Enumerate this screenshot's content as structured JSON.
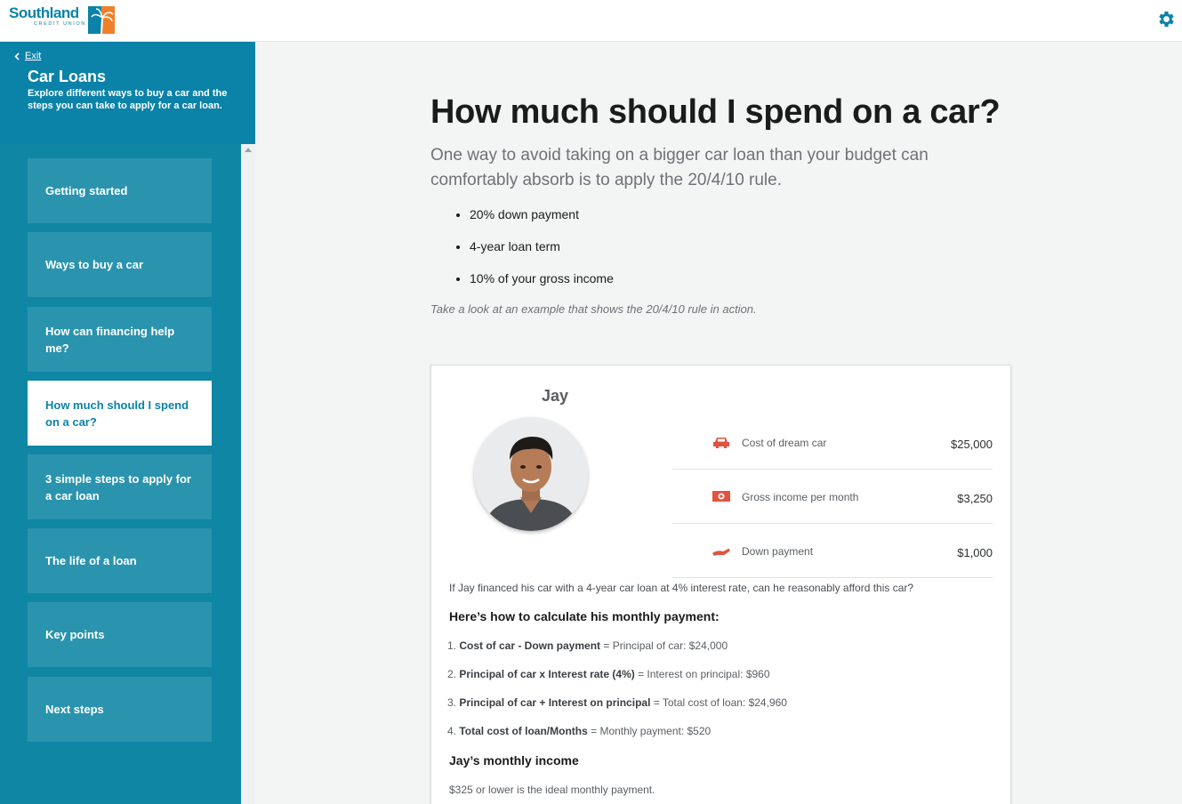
{
  "header": {
    "logo_name": "Southland",
    "logo_sub": "CREDIT UNION",
    "settings_icon": "gear-icon"
  },
  "colors": {
    "brand": "#0b82a8",
    "sidebar_item": "#2a94ae",
    "accent_red": "#e2523f",
    "logo_orange": "#f07f2a"
  },
  "sidebar": {
    "exit_label": "Exit",
    "title": "Car Loans",
    "description": "Explore different ways to buy a car and the steps you can take to apply for a car loan.",
    "items": [
      {
        "label": "Getting started"
      },
      {
        "label": "Ways to buy a car"
      },
      {
        "label": "How can financing help me?"
      },
      {
        "label": "How much should I spend on a car?"
      },
      {
        "label": "3 simple steps to apply for a car loan"
      },
      {
        "label": "The life of a loan"
      },
      {
        "label": "Key points"
      },
      {
        "label": "Next steps"
      }
    ],
    "active_index": 3
  },
  "main": {
    "title": "How much should I spend on a car?",
    "intro": "One way to avoid taking on a bigger car loan than your budget can comfortably absorb is to apply the 20/4/10 rule.",
    "bullets": [
      "20% down payment",
      "4-year loan term",
      "10% of your gross income"
    ],
    "note": "Take a look at an example that shows the 20/4/10 rule in action."
  },
  "card": {
    "person_name": "Jay",
    "stats": [
      {
        "icon": "car-icon",
        "label": "Cost of dream car",
        "value": "$25,000"
      },
      {
        "icon": "money-icon",
        "label": "Gross income per month",
        "value": "$3,250"
      },
      {
        "icon": "hand-icon",
        "label": "Down payment",
        "value": "$1,000"
      }
    ],
    "question": "If Jay financed his car with a 4-year car loan at 4% interest rate, can he reasonably afford this car?",
    "calc_title": "Here’s how to calculate his monthly payment:",
    "calc": [
      {
        "num": "1. ",
        "bold": "Cost of car - Down payment",
        "rest": " = Principal of car: $24,000"
      },
      {
        "num": "2. ",
        "bold": "Principal of car x Interest rate (4%)",
        "rest": " = Interest on principal: $960"
      },
      {
        "num": "3. ",
        "bold": "Principal of car + Interest on principal",
        "rest": " = Total cost of loan: $24,960"
      },
      {
        "num": "4. ",
        "bold": "Total cost of loan/Months",
        "rest": " = Monthly payment: $520"
      }
    ],
    "income_title": "Jay’s monthly income",
    "income_text": "$325 or lower is the ideal monthly payment."
  }
}
